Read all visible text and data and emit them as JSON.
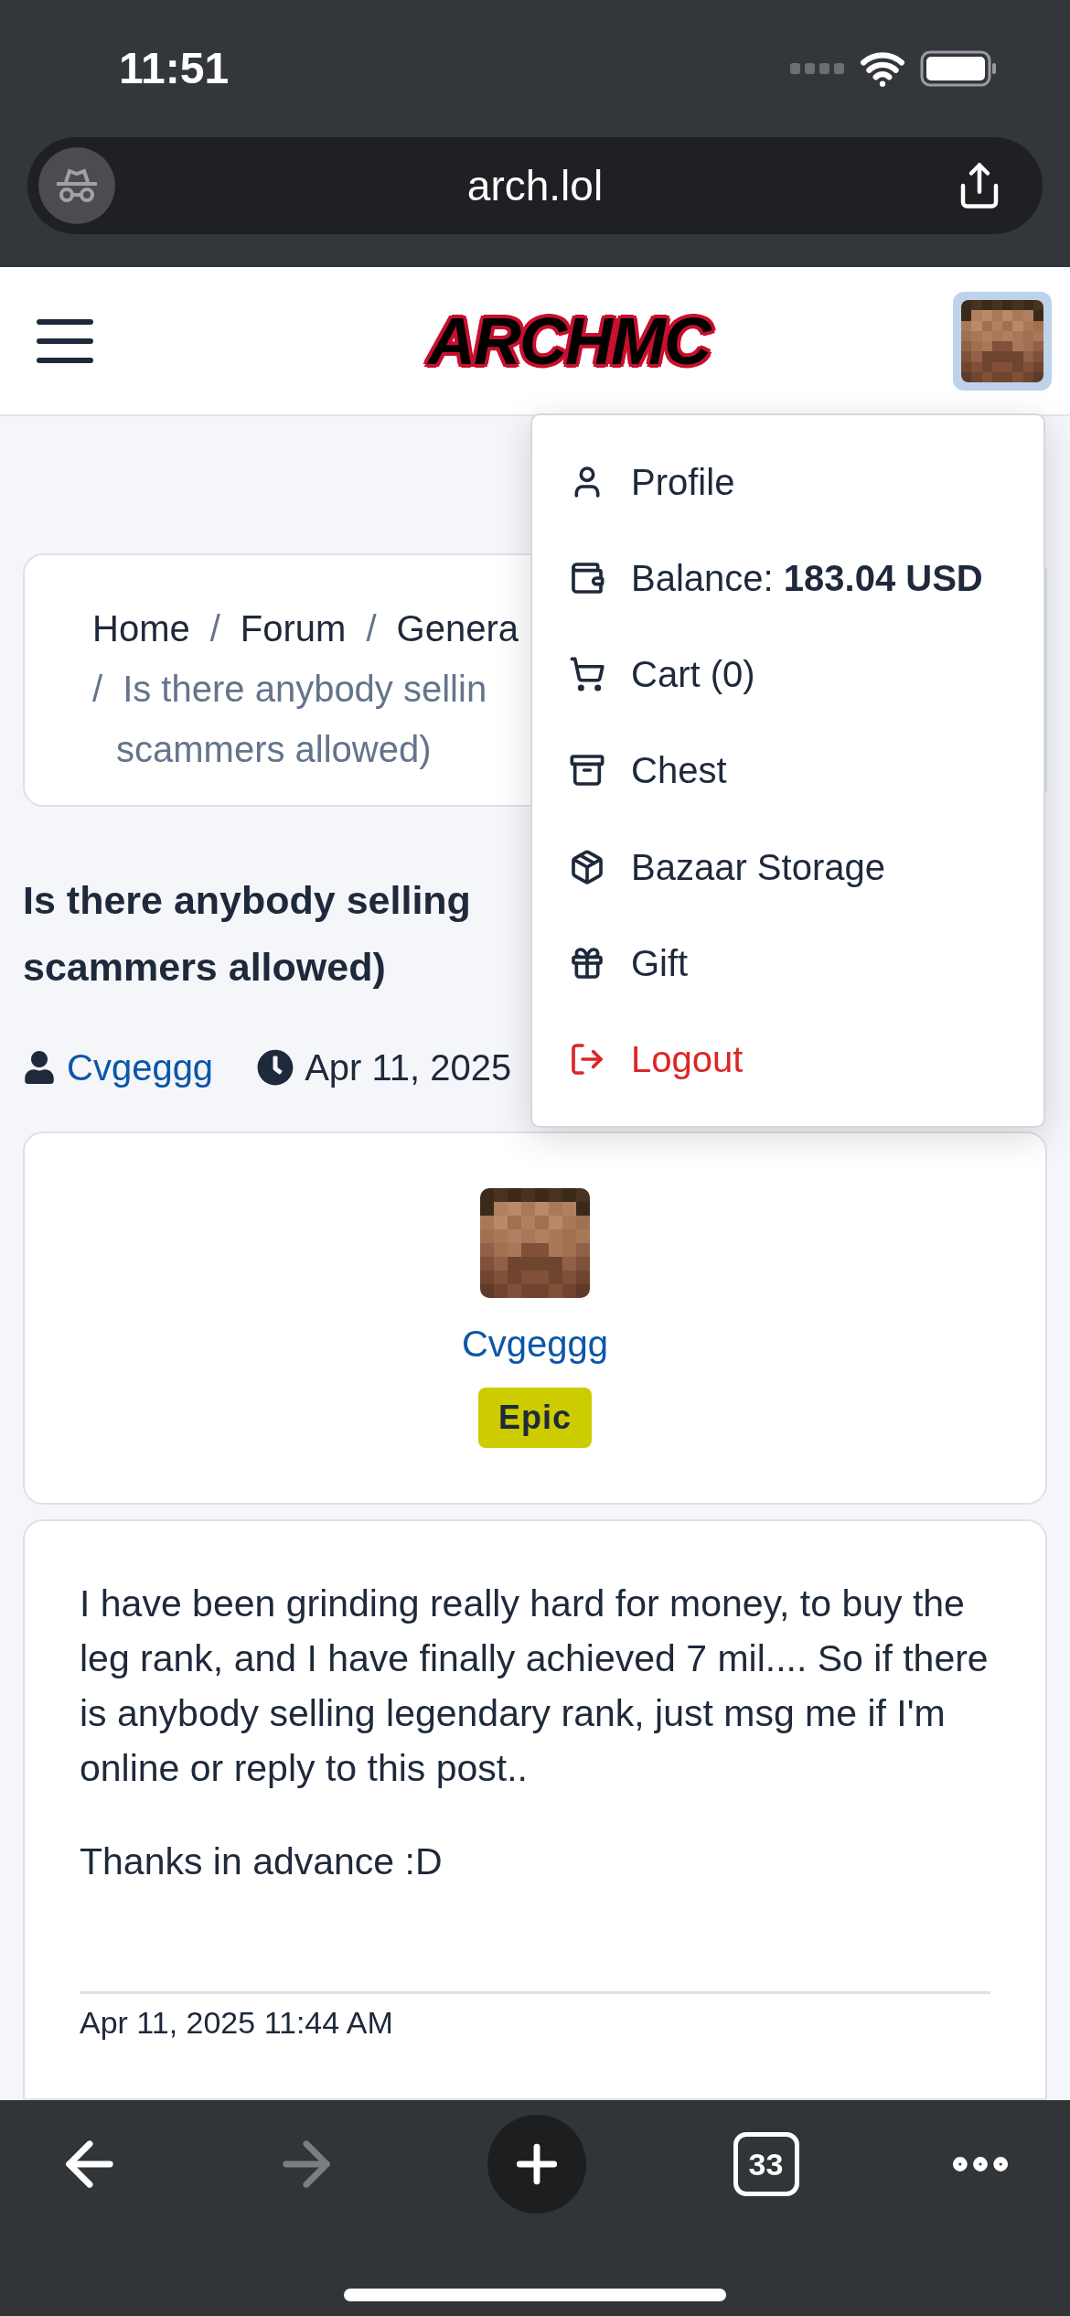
{
  "status_bar": {
    "time": "11:51"
  },
  "browser": {
    "url": "arch.lol",
    "tab_count": "33",
    "back": {
      "disabled": false
    },
    "forward": {
      "disabled": true
    }
  },
  "header": {
    "logo": "ARCHMC"
  },
  "account_menu": {
    "items": [
      {
        "label": "Profile",
        "kind": "normal"
      },
      {
        "label": "Balance: **183.04 USD**",
        "kind": "normal"
      },
      {
        "label": "Cart (0)",
        "kind": "normal"
      },
      {
        "label": "Chest",
        "kind": "normal"
      },
      {
        "label": "Bazaar Storage",
        "kind": "normal"
      },
      {
        "label": "Gift",
        "kind": "normal"
      },
      {
        "label": "Logout",
        "kind": "danger"
      }
    ]
  },
  "breadcrumb": {
    "separator": "/",
    "links": [
      "Home",
      "Forum",
      "Genera"
    ],
    "current_lines": [
      "Is there anybody sellin",
      "scammers allowed)"
    ]
  },
  "thread": {
    "title_lines": [
      "Is there anybody selling",
      "scammers allowed)"
    ],
    "author": "Cvgeggg",
    "date": "Apr 11, 2025"
  },
  "author_card": {
    "name": "Cvgeggg",
    "rank": {
      "label": "Epic",
      "color": "#cccc00"
    }
  },
  "post": {
    "paragraphs": [
      "I have been grinding really hard for money, to buy the leg rank, and I have finally achieved 7 mil.... So if there is anybody selling legendary rank, just msg me if I'm online or reply to this post..",
      "Thanks in advance :D"
    ],
    "timestamp": "Apr 11, 2025 11:44 AM"
  }
}
